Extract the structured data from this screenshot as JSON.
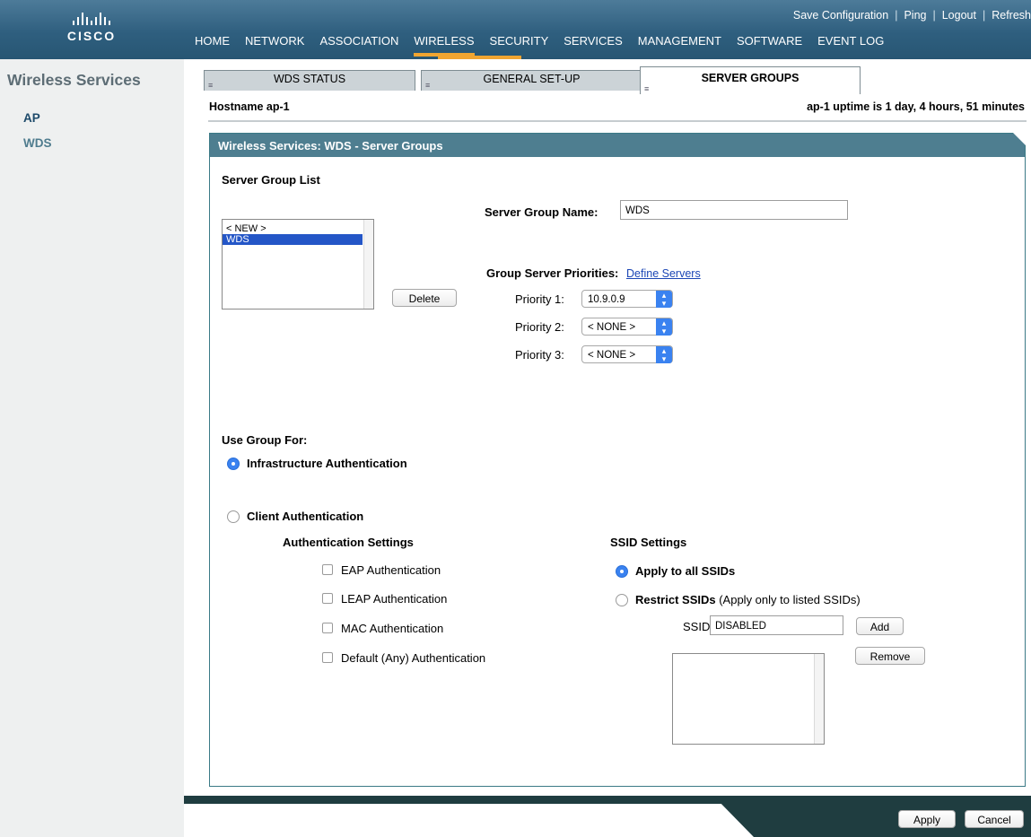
{
  "brand": {
    "logo_text": "CISCO"
  },
  "utility_links": [
    "Save Configuration",
    "Ping",
    "Logout",
    "Refresh"
  ],
  "main_nav": [
    "HOME",
    "NETWORK",
    "ASSOCIATION",
    "WIRELESS",
    "SECURITY",
    "SERVICES",
    "MANAGEMENT",
    "SOFTWARE",
    "EVENT LOG"
  ],
  "main_nav_active": "WIRELESS",
  "sidebar": {
    "title": "Wireless Services",
    "items": [
      "AP",
      "WDS"
    ],
    "selected": "WDS"
  },
  "tabs": [
    "WDS STATUS",
    "GENERAL SET-UP",
    "SERVER GROUPS"
  ],
  "active_tab": "SERVER GROUPS",
  "host": {
    "label": "Hostname ap-1",
    "uptime": "ap-1 uptime is 1 day, 4 hours, 51 minutes"
  },
  "panel": {
    "title": "Wireless Services: WDS - Server Groups",
    "server_group_list_label": "Server Group List",
    "server_group_list": [
      "< NEW >",
      "WDS"
    ],
    "server_group_selected": "WDS",
    "delete_label": "Delete",
    "server_group_name_label": "Server Group Name:",
    "server_group_name_value": "WDS",
    "priorities_label": "Group Server Priorities:",
    "define_servers_label": "Define Servers",
    "priorities": [
      {
        "label": "Priority 1:",
        "value": "10.9.0.9"
      },
      {
        "label": "Priority 2:",
        "value": "< NONE >"
      },
      {
        "label": "Priority 3:",
        "value": "< NONE >"
      }
    ],
    "use_group_for_label": "Use Group For:",
    "infra_auth_label": "Infrastructure Authentication",
    "client_auth_label": "Client Authentication",
    "use_group_for_selected": "Infrastructure Authentication",
    "auth_settings_label": "Authentication Settings",
    "auth_options": [
      {
        "label": "EAP Authentication",
        "checked": false
      },
      {
        "label": "LEAP Authentication",
        "checked": false
      },
      {
        "label": "MAC Authentication",
        "checked": false
      },
      {
        "label": "Default (Any) Authentication",
        "checked": false
      }
    ],
    "ssid_settings_label": "SSID Settings",
    "apply_all_label": "Apply to all SSIDs",
    "restrict_label": "Restrict SSIDs",
    "restrict_note": "(Apply only to listed SSIDs)",
    "ssid_mode_selected": "Apply to all SSIDs",
    "ssid_label": "SSID:",
    "ssid_value": "DISABLED",
    "add_label": "Add",
    "remove_label": "Remove"
  },
  "footer": {
    "apply_label": "Apply",
    "cancel_label": "Cancel"
  },
  "colors": {
    "header": "#2f5f7f",
    "nav_accent": "#f0a531",
    "panel_header": "#4e7e90",
    "footer_bar": "#1f3d40",
    "radio_on": "#3a82f0"
  }
}
